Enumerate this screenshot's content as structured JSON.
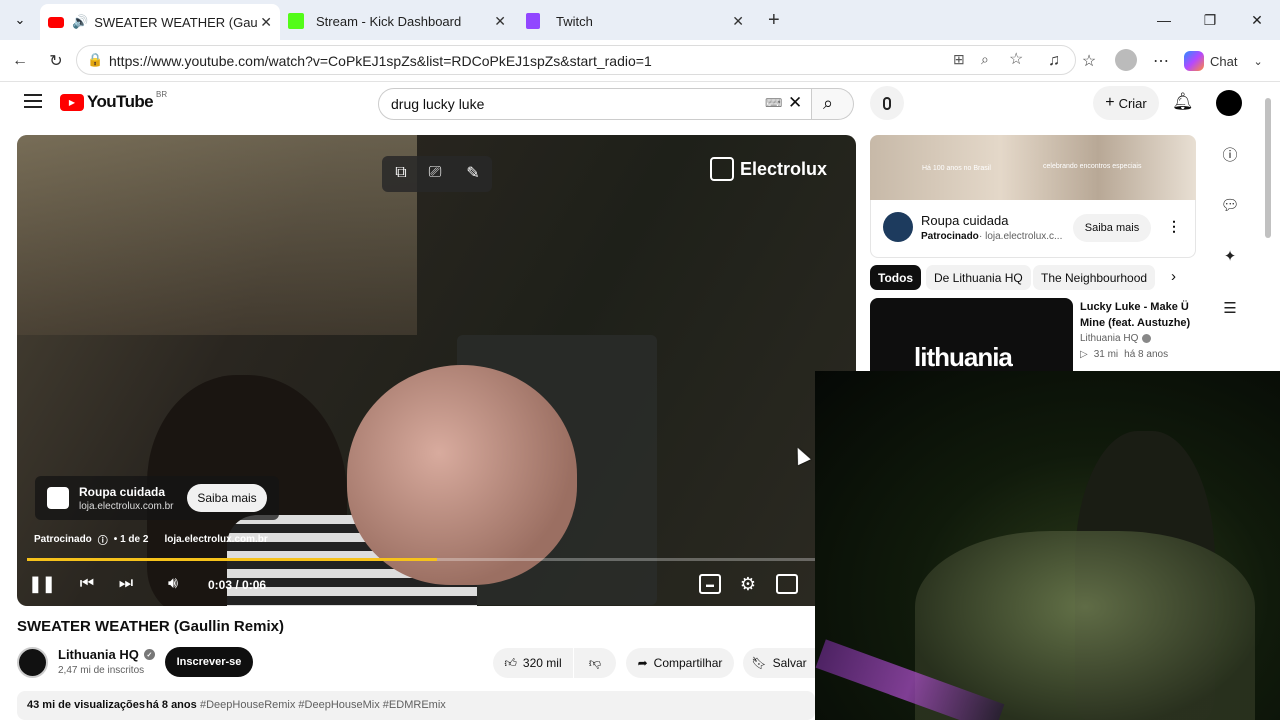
{
  "browser": {
    "tabs": [
      {
        "title": "SWEATER WEATHER (Gaullin R",
        "active": true
      },
      {
        "title": "Stream - Kick Dashboard",
        "active": false
      },
      {
        "title": "Twitch",
        "active": false
      }
    ],
    "url": "https://www.youtube.com/watch?v=CoPkEJ1spZs&list=RDCoPkEJ1spZs&start_radio=1",
    "chat_label": "Chat"
  },
  "youtube": {
    "logo_text": "YouTube",
    "region": "BR",
    "search_value": "drug lucky luke",
    "create_label": "Criar"
  },
  "player": {
    "brand_watermark": "Electrolux",
    "ad_title": "Roupa cuidada",
    "ad_domain": "loja.electrolux.com.br",
    "ad_button": "Saiba mais",
    "sponsored": "Patrocinado",
    "ad_count": "• 1 de 2",
    "ad_link": "loja.electrolux.com.br",
    "time": "0:03 / 0:06",
    "progress_fraction": 0.52
  },
  "video_info": {
    "title": "SWEATER WEATHER (Gaullin Remix)",
    "channel": "Lithuania HQ",
    "subscribers": "2,47 mi de inscritos",
    "subscribe_label": "Inscrever-se",
    "likes": "320 mil",
    "share_label": "Compartilhar",
    "save_label": "Salvar",
    "views": "43 mi de visualizações",
    "age": "há 8 anos",
    "hashtags": "#DeepHouseRemix #DeepHouseMix #EDMREmix"
  },
  "sidebar": {
    "ad_banner_text1": "Há 100 anos no Brasil",
    "ad_banner_text2": "celebrando encontros especiais",
    "ad_title": "Roupa cuidada",
    "ad_sponsored": "Patrocinado",
    "ad_domain": "· loja.electrolux.c...",
    "ad_button": "Saiba mais",
    "chips": [
      "Todos",
      "De Lithuania HQ",
      "The Neighbourhood"
    ],
    "rec_title_1": "Lucky Luke - Make Ü",
    "rec_title_2": "Mine (feat. Austuzhe)",
    "rec_channel": "Lithuania HQ",
    "rec_meta_1": "31 mi",
    "rec_meta_2": "há 8 anos",
    "rec_thumb_text": "lithuania"
  }
}
